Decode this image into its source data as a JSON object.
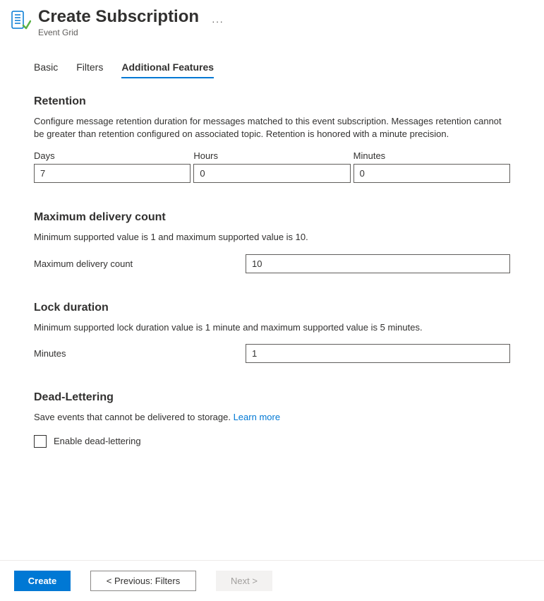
{
  "header": {
    "title": "Create Subscription",
    "subtitle": "Event Grid"
  },
  "tabs": {
    "basic": "Basic",
    "filters": "Filters",
    "additional": "Additional Features"
  },
  "retention": {
    "title": "Retention",
    "desc": "Configure message retention duration for messages matched to this event subscription. Messages retention cannot be greater than retention configured on associated topic. Retention is honored with a minute precision.",
    "days_label": "Days",
    "days_value": "7",
    "hours_label": "Hours",
    "hours_value": "0",
    "minutes_label": "Minutes",
    "minutes_value": "0"
  },
  "delivery": {
    "title": "Maximum delivery count",
    "desc": "Minimum supported value is 1 and maximum supported value is 10.",
    "label": "Maximum delivery count",
    "value": "10"
  },
  "lock": {
    "title": "Lock duration",
    "desc": "Minimum supported lock duration value is 1 minute and maximum supported value is 5 minutes.",
    "label": "Minutes",
    "value": "1"
  },
  "deadletter": {
    "title": "Dead-Lettering",
    "desc": "Save events that cannot be delivered to storage. ",
    "link": "Learn more",
    "checkbox_label": "Enable dead-lettering"
  },
  "footer": {
    "create": "Create",
    "previous": "< Previous: Filters",
    "next": "Next >"
  }
}
